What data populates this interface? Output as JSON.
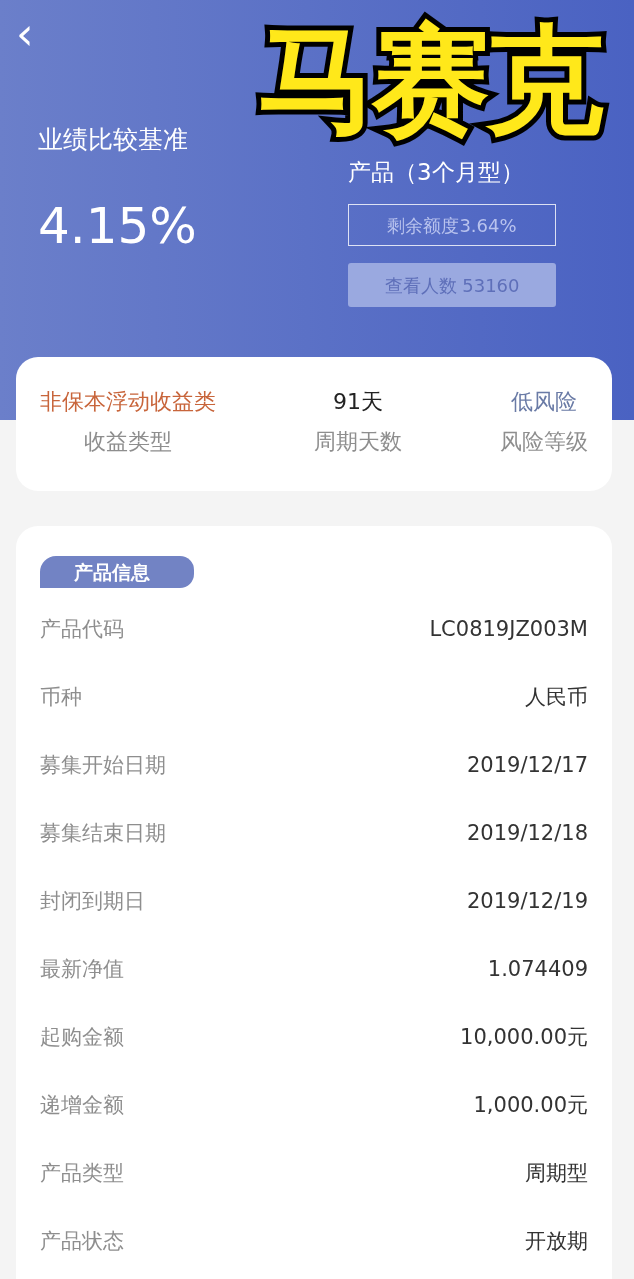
{
  "header": {
    "back": "‹",
    "benchmark_label": "业绩比较基准",
    "benchmark_value": "4.15%",
    "product_title": "产品（3个月型）",
    "remaining_quota": "剩余额度3.64%",
    "viewers_button": "查看人数 53160"
  },
  "overlay": {
    "text": "马赛克"
  },
  "summary": [
    {
      "value": "非保本浮动收益类",
      "label": "收益类型",
      "color": "#c8653b"
    },
    {
      "value": "91天",
      "label": "周期天数",
      "color": "#222222"
    },
    {
      "value": "低风险",
      "label": "风险等级",
      "color": "#6a7ba6"
    }
  ],
  "info": {
    "tag": "产品信息",
    "rows": [
      {
        "label": "产品代码",
        "value": "LC0819JZ003M"
      },
      {
        "label": "币种",
        "value": "人民币"
      },
      {
        "label": "募集开始日期",
        "value": "2019/12/17"
      },
      {
        "label": "募集结束日期",
        "value": "2019/12/18"
      },
      {
        "label": "封闭到期日",
        "value": "2019/12/19"
      },
      {
        "label": "最新净值",
        "value": "1.074409"
      },
      {
        "label": "起购金额",
        "value": "10,000.00元"
      },
      {
        "label": "递增金额",
        "value": "1,000.00元"
      },
      {
        "label": "产品类型",
        "value": "周期型"
      },
      {
        "label": "产品状态",
        "value": "开放期"
      }
    ]
  }
}
